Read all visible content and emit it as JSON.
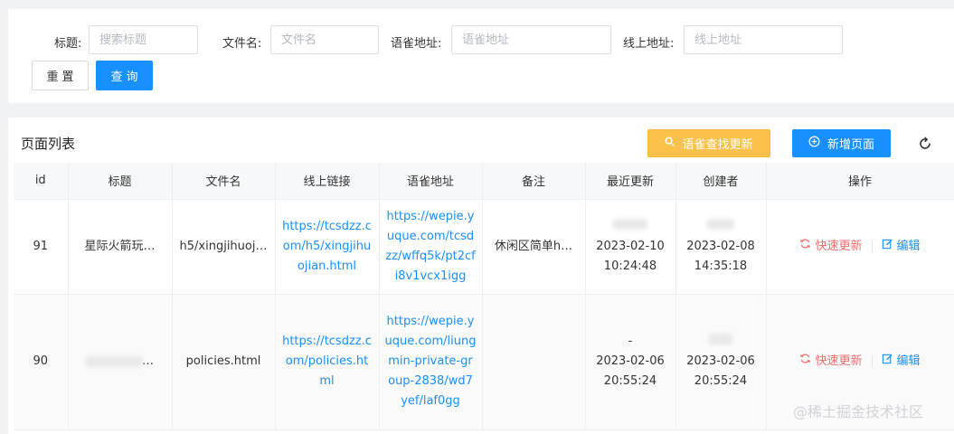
{
  "search": {
    "title_label": "标题:",
    "title_placeholder": "搜索标题",
    "filename_label": "文件名:",
    "filename_placeholder": "文件名",
    "yuque_label": "语雀地址:",
    "yuque_placeholder": "语雀地址",
    "online_label": "线上地址:",
    "online_placeholder": "线上地址",
    "reset_label": "重置",
    "query_label": "查询"
  },
  "list": {
    "title": "页面列表",
    "yuque_button": "语雀查找更新",
    "new_button": "新增页面",
    "icons": {
      "yuque": "search-icon",
      "new": "plus-circle-icon",
      "refresh": "refresh-icon"
    },
    "accent": "#1890ff",
    "warning": "#fac24a",
    "danger": "#f56c6c"
  },
  "table": {
    "headers": [
      "id",
      "标题",
      "文件名",
      "线上链接",
      "语雀地址",
      "备注",
      "最近更新",
      "创建者",
      "操作"
    ],
    "rows": [
      {
        "id": "91",
        "title": "星际火箭玩…",
        "filename": "h5/xingjihuoj…",
        "online_link": "https://tcsdzz.com/h5/xingjihuojian.html",
        "yuque": "https://wepie.yuque.com/tcsdzz/wffq5k/pt2cfi8v1vcx1igg",
        "remark": "休闲区简单h…",
        "updated_date": "2023-02-10",
        "updated_time": "10:24:48",
        "created_date": "2023-02-08",
        "created_time": "14:35:18",
        "op_update": "快速更新",
        "op_edit": "编辑"
      },
      {
        "id": "90",
        "title": "…",
        "filename": "policies.html",
        "online_link": "https://tcsdzz.com/policies.html",
        "yuque": "https://wepie.yuque.com/liungmin-private-group-2838/wd7yef/laf0gg",
        "remark": "",
        "updated_prefix": "-",
        "updated_date": "2023-02-06",
        "updated_time": "20:55:24",
        "created_date": "2023-02-06",
        "created_time": "20:55:24",
        "op_update": "快速更新",
        "op_edit": "编辑"
      }
    ]
  },
  "watermark": "@稀土掘金技术社区"
}
